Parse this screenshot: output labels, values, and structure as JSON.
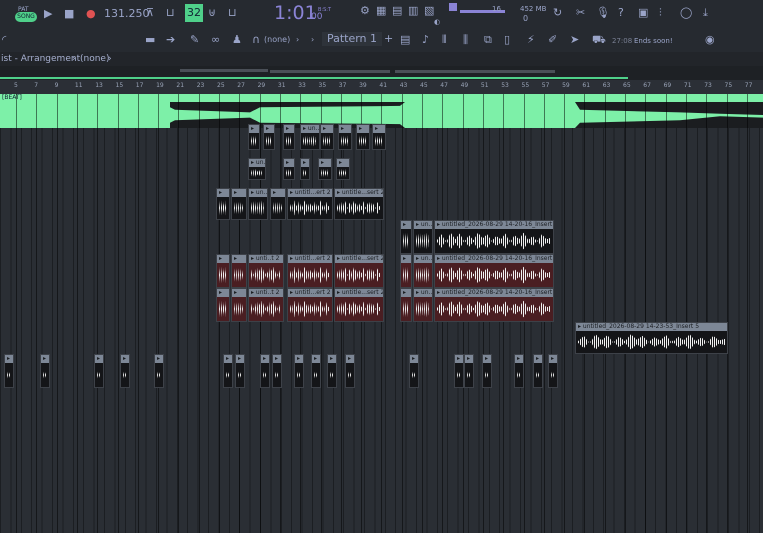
{
  "toolbar": {
    "mode_top": "PAT",
    "mode_song": "SONG",
    "tempo": "131.250",
    "time": "1:01",
    "time_sub": "00",
    "time_label": "B:S:T",
    "step_label": "32",
    "cpu_value": "16",
    "mem_value": "452 MB",
    "mem_small": "0"
  },
  "toolbar2": {
    "snap_label": "(none)",
    "pattern_label": "Pattern 1",
    "add_symbol": "+",
    "news_time": "27:08",
    "news_text": "Ends soon!"
  },
  "hint": {
    "left": "ist - Arrangement",
    "sep": "›",
    "right": "(none)",
    "sep2": "›"
  },
  "ruler": {
    "ticks": [
      "5",
      "7",
      "9",
      "11",
      "13",
      "15",
      "17",
      "19",
      "21",
      "23",
      "25",
      "27",
      "29",
      "31",
      "33",
      "35",
      "37",
      "39",
      "41",
      "43",
      "45",
      "47",
      "49",
      "51",
      "53",
      "55",
      "57",
      "59",
      "61",
      "63",
      "65",
      "67",
      "69",
      "71",
      "73",
      "75",
      "77",
      "79"
    ]
  },
  "tracks": {
    "beat_label": "[BEAT]",
    "clip_label_short": "un..",
    "clip_label_mid1": "unti..t 2",
    "clip_label_mid2": "untitl...ert 2",
    "clip_label_mid3": "untitle...sert 2",
    "clip_label_long1": "untitled_2026-08-29 14-20-16_Insert 2",
    "clip_label_long2": "untitled_2026-08-29 14-23-53_Insert 5"
  },
  "colors": {
    "beat": "#7df0a8",
    "accent": "#8b84d6",
    "clip_header": "#7d8796",
    "clip_red": "#4a1e22"
  }
}
